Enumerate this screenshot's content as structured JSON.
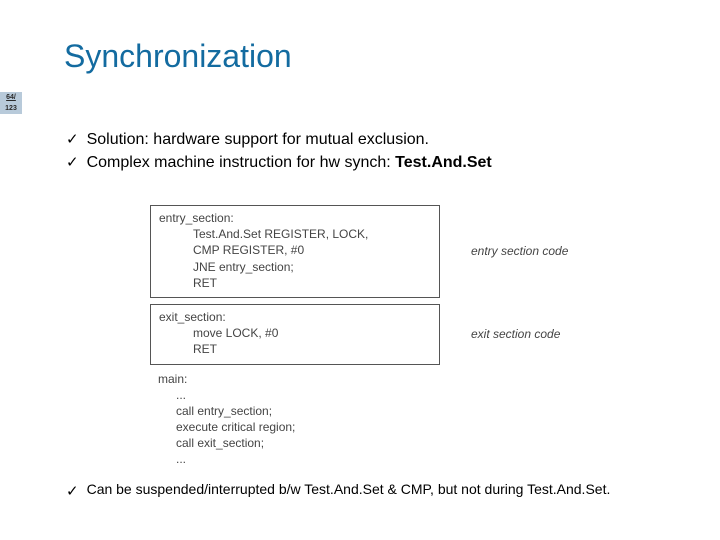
{
  "title": "Synchronization",
  "badge": {
    "top": "64/",
    "bottom": "123"
  },
  "bullets": {
    "b1": "Solution: hardware support for mutual exclusion.",
    "b2_prefix": "Complex machine instruction for hw synch: ",
    "b2_bold": "Test.And.Set"
  },
  "code": {
    "entry_label": "entry_section:",
    "entry_l1": "Test.And.Set   REGISTER, LOCK,",
    "entry_l2": "CMP REGISTER, #0",
    "entry_l3": "JNE  entry_section;",
    "entry_l4": "RET",
    "entry_annot": "entry section code",
    "exit_label": "exit_section:",
    "exit_l1": "move LOCK, #0",
    "exit_l2": "RET",
    "exit_annot": "exit section code",
    "main_label": "main:",
    "main_dots": "...",
    "main_l1": "call entry_section;",
    "main_l2": "execute critical region;",
    "main_l3": "call exit_section;",
    "main_dots2": "..."
  },
  "footnote": "Can be suspended/interrupted b/w Test.And.Set & CMP, but not during Test.And.Set.",
  "checkmark": "✓"
}
